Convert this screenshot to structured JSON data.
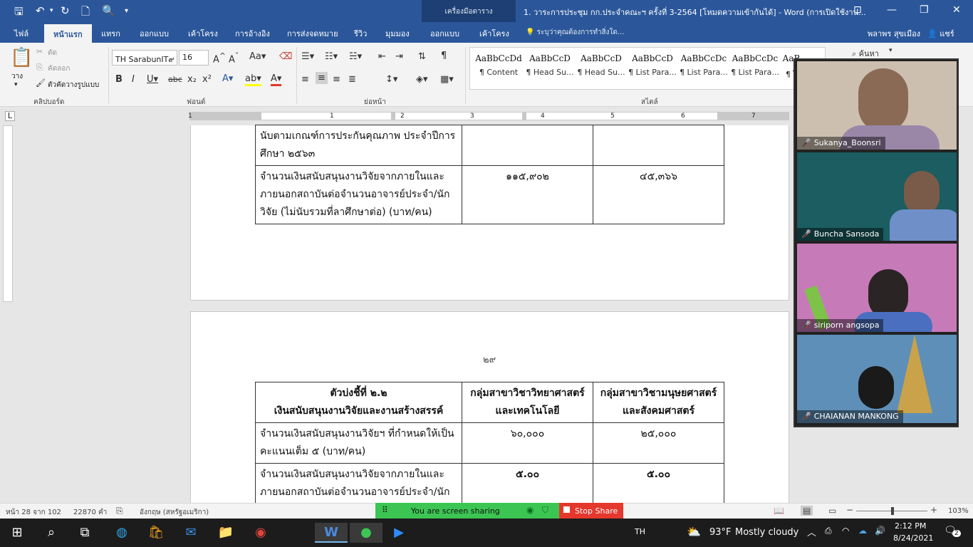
{
  "titlebar": {
    "context_tab": "เครื่องมือตาราง",
    "doc_title": "1. วาระการประชุม กก.ประจำคณะฯ ครั้งที่ 3-2564 [โหมดความเข้ากันได้] - Word (การเปิดใช้งาน..."
  },
  "tabs": {
    "file": "ไฟล์",
    "home": "หน้าแรก",
    "insert": "แทรก",
    "design": "ออกแบบ",
    "layout": "เค้าโครง",
    "references": "การอ้างอิง",
    "mailings": "การส่งจดหมาย",
    "review": "รีวิว",
    "view": "มุมมอง",
    "table_design": "ออกแบบ",
    "table_layout": "เค้าโครง",
    "tell_me": "ระบุว่าคุณต้องการทำสิ่งใด...",
    "user": "พลาพร สุขเมือง",
    "share": "แชร์"
  },
  "ribbon": {
    "clipboard": {
      "paste": "วาง",
      "cut": "ตัด",
      "copy": "คัดลอก",
      "format_painter": "ตัวคัดวางรูปแบบ",
      "label": "คลิปบอร์ด"
    },
    "font": {
      "name": "TH SarabunIT๙",
      "size": "16",
      "label": "ฟอนต์"
    },
    "paragraph": {
      "label": "ย่อหน้า"
    },
    "styles": {
      "label": "สไตล์",
      "items": [
        {
          "sample": "AaBbCcDd",
          "name": "¶ Content"
        },
        {
          "sample": "AaBbCcD",
          "name": "¶ Head Su..."
        },
        {
          "sample": "AaBbCcD",
          "name": "¶ Head Su..."
        },
        {
          "sample": "AaBbCcD",
          "name": "¶ List Para..."
        },
        {
          "sample": "AaBbCcDc",
          "name": "¶ List Para..."
        },
        {
          "sample": "AaBbCcDc",
          "name": "¶ List Para..."
        },
        {
          "sample": "AaB",
          "name": "¶ ไ"
        }
      ]
    },
    "editing": {
      "find": "ค้นหา"
    }
  },
  "ruler": {
    "marks": [
      "1",
      "1",
      "2",
      "3",
      "4",
      "5",
      "6",
      "7"
    ]
  },
  "page1": {
    "rows": [
      {
        "c1": "นับตามเกณฑ์การประกันคุณภาพ ประจำปีการศึกษา ๒๕๖๓",
        "c2": "",
        "c3": ""
      },
      {
        "c1": "จำนวนเงินสนับสนุนงานวิจัยจากภายในและภายนอกสถาบันต่อจำนวนอาจารย์ประจำ/นักวิจัย (ไม่นับรวมที่ลาศึกษาต่อ) (บาท/คน)",
        "c2": "๑๑๕,๙๐๒",
        "c3": "๔๕,๓๖๖"
      }
    ]
  },
  "page2": {
    "page_number": "๒๙",
    "header": {
      "c1_line1": "ตัวบ่งชี้ที่ ๒.๒",
      "c1_line2": "เงินสนับสนุนงานวิจัยและงานสร้างสรรค์",
      "c2": "กลุ่มสาขาวิชาวิทยาศาสตร์และเทคโนโลยี",
      "c3": "กลุ่มสาขาวิชามนุษยศาสตร์และสังคมศาสตร์"
    },
    "rows": [
      {
        "c1": "จำนวนเงินสนับสนุนงานวิจัยฯ ที่กำหนดให้เป็นคะแนนเต็ม ๕ (บาท/คน)",
        "c2": "๖๐,๐๐๐",
        "c3": "๒๕,๐๐๐"
      },
      {
        "c1": "จำนวนเงินสนับสนุนงานวิจัยจากภายในและภายนอกสถาบันต่อจำนวนอาจารย์ประจำ/นักวิจัย (ไม่นับรวมที่ลาศึกษาต่อ)",
        "c2": "๕.๐๐",
        "c3": "๕.๐๐"
      }
    ]
  },
  "statusbar": {
    "page": "หน้า 28 จาก 102",
    "words": "22870 คำ",
    "language": "อังกฤษ (สหรัฐอเมริกา)",
    "zoom": "103%"
  },
  "screenshare": {
    "sharing": "You are screen sharing",
    "stop": "Stop Share"
  },
  "participants": [
    {
      "name": "Sukanya_Boonsri",
      "bg": "#cdbfb0"
    },
    {
      "name": "Buncha Sansoda",
      "bg": "#1b5d60"
    },
    {
      "name": "siriporn angsopa",
      "bg": "#c77ab8"
    },
    {
      "name": "CHAIANAN MANKONG",
      "bg": "#5e8fb8"
    }
  ],
  "taskbar": {
    "lang": "TH",
    "temp": "93°F",
    "weather": "Mostly cloudy",
    "time": "2:12 PM",
    "date": "8/24/2021",
    "notif": "2"
  },
  "colors": {
    "word_blue": "#2b579a",
    "share_green": "#3cc553",
    "stop_red": "#e5372c"
  }
}
